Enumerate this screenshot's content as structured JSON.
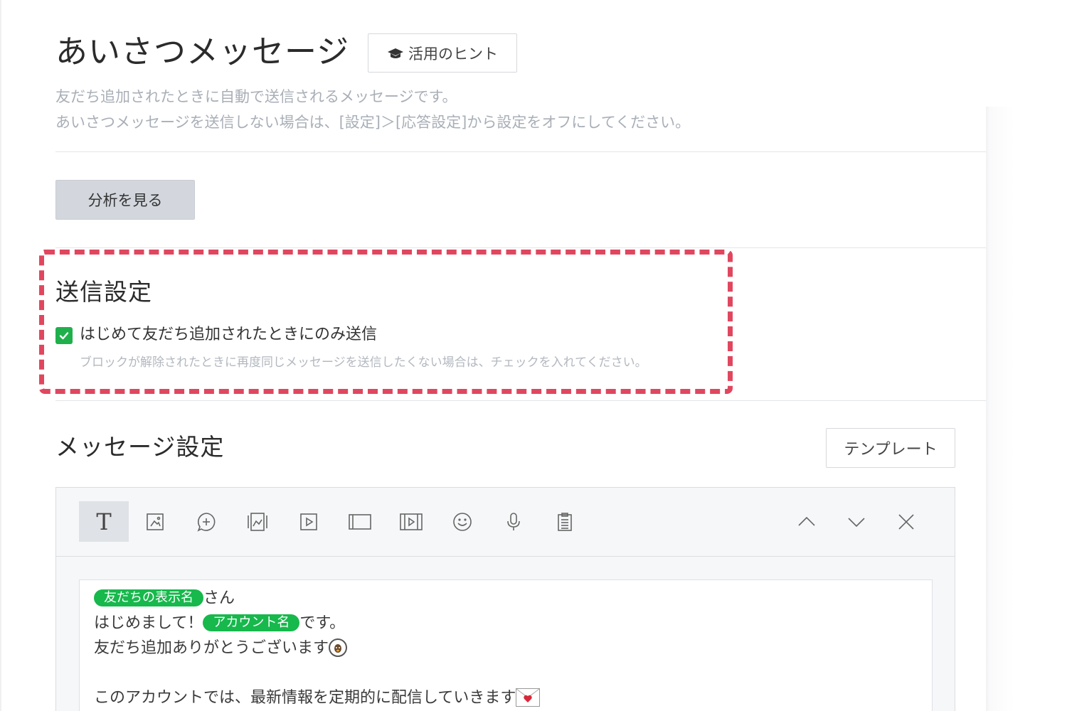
{
  "header": {
    "title": "あいさつメッセージ",
    "hint_button_label": "活用のヒント",
    "description_line1": "友だち追加されたときに自動で送信されるメッセージです。",
    "description_line2": "あいさつメッセージを送信しない場合は、[設定]＞[応答設定]から設定をオフにしてください。"
  },
  "analytics_button_label": "分析を見る",
  "send_settings": {
    "title": "送信設定",
    "checkbox_checked": true,
    "checkbox_label": "はじめて友だち追加されたときにのみ送信",
    "checkbox_note": "ブロックが解除されたときに再度同じメッセージを送信したくない場合は、チェックを入れてください。"
  },
  "message_settings": {
    "title": "メッセージ設定",
    "template_button_label": "テンプレート",
    "toolbar": {
      "tools": [
        "text-icon",
        "image-icon",
        "add-bubble-icon",
        "card-icon",
        "video-icon",
        "rich-message-icon",
        "rich-video-icon",
        "emoji-icon",
        "voice-icon",
        "survey-icon"
      ],
      "controls": [
        "chevron-up-icon",
        "chevron-down-icon",
        "close-icon"
      ]
    },
    "message": {
      "line1_tag": "友だちの表示名",
      "line1_suffix": "さん",
      "line2_prefix": "はじめまして！",
      "line2_tag": "アカウント名",
      "line2_suffix": "です。",
      "line3": "友だち追加ありがとうございます",
      "line5": "このアカウントでは、最新情報を定期的に配信していきます"
    }
  },
  "colors": {
    "accent_green": "#17b84c",
    "highlight_dashed": "#e0475f",
    "muted_text": "#a9afb7"
  }
}
